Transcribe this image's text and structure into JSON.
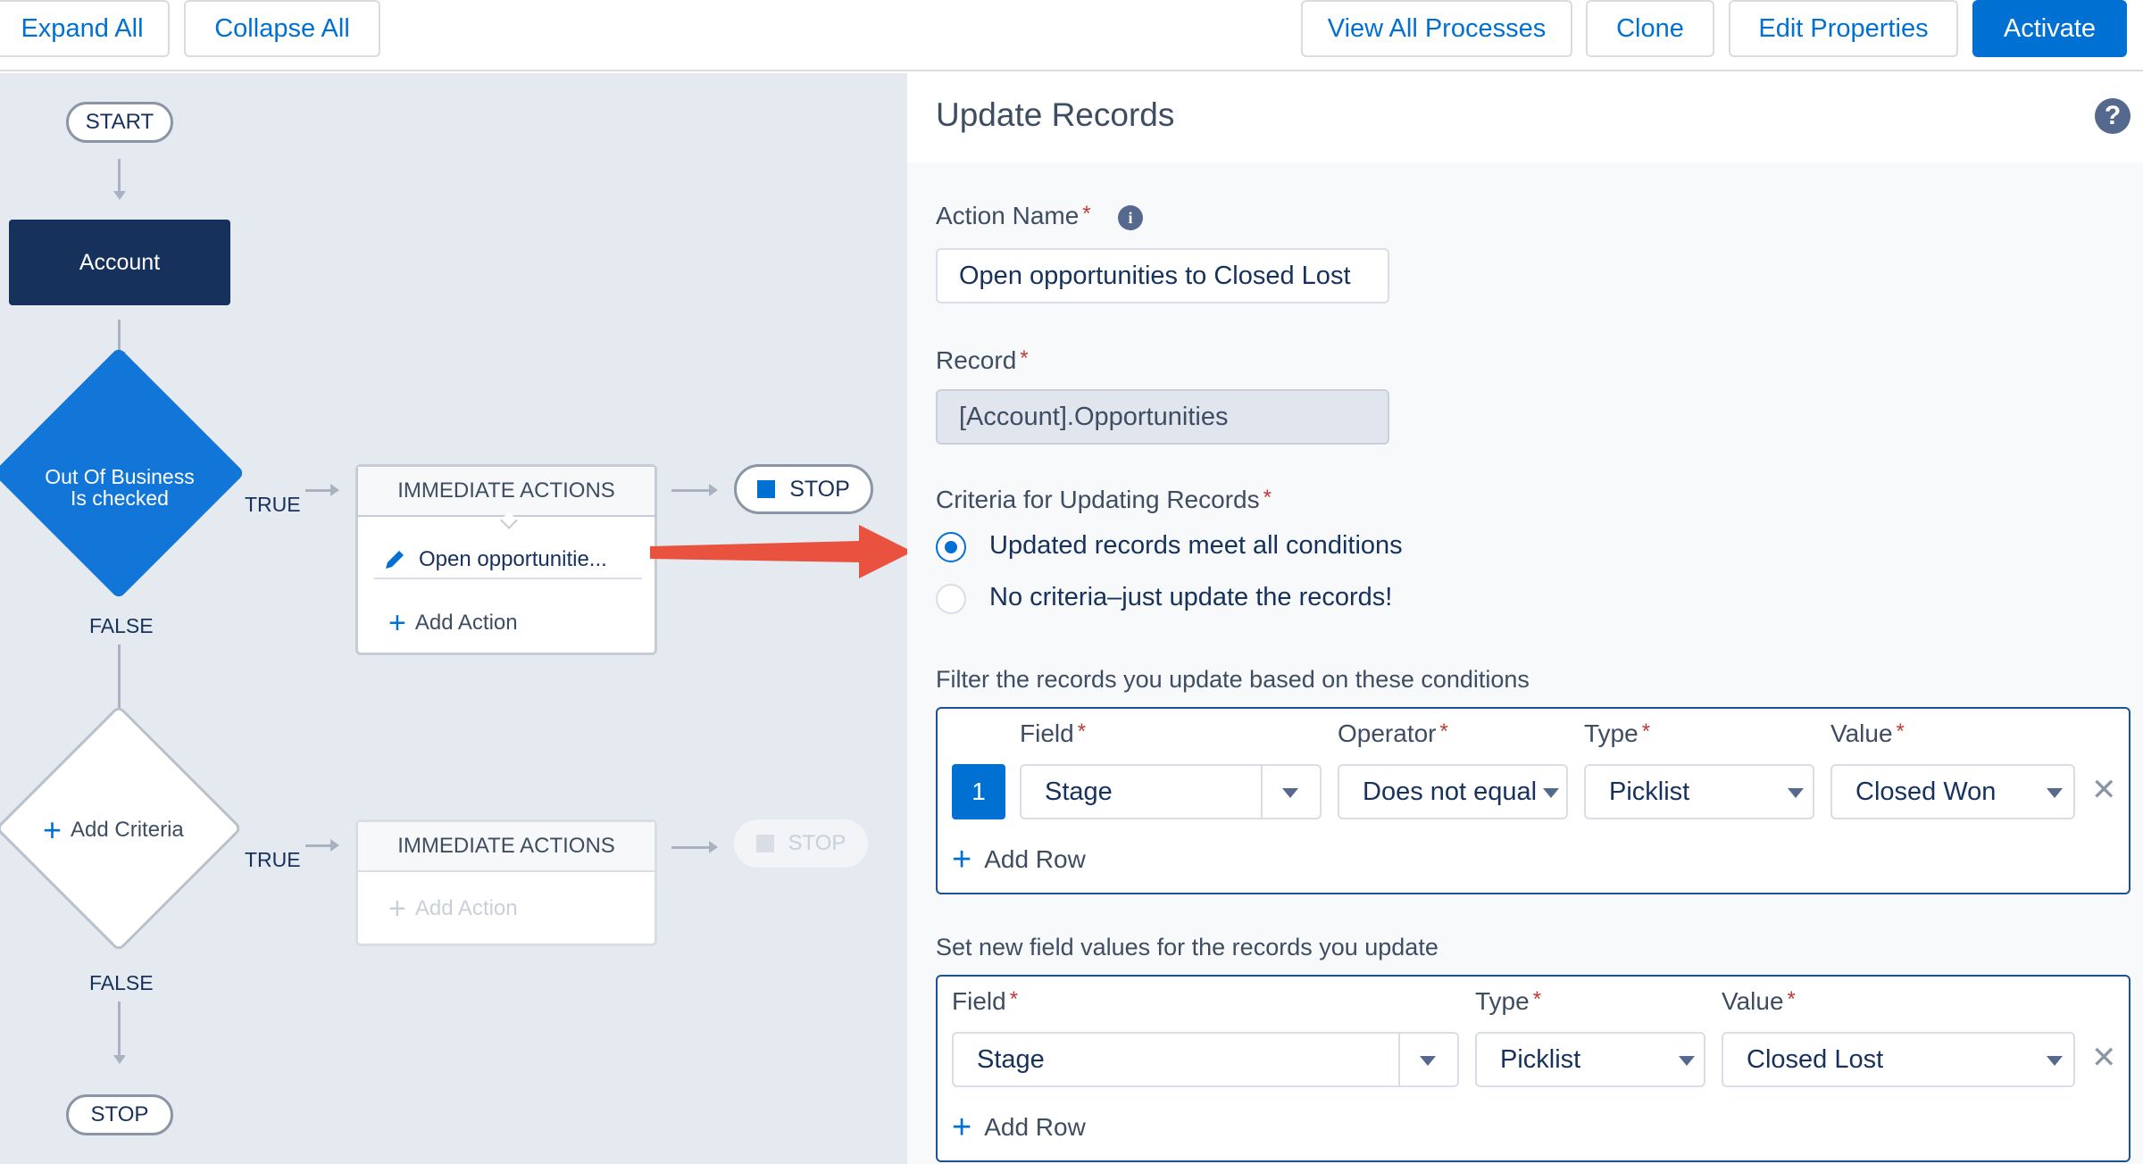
{
  "toolbar": {
    "expand_all": "Expand All",
    "collapse_all": "Collapse All",
    "view_all_processes": "View All Processes",
    "clone": "Clone",
    "edit_properties": "Edit Properties",
    "activate": "Activate"
  },
  "canvas": {
    "start_label": "START",
    "object_node": "Account",
    "criteria1_line1": "Out Of Business",
    "criteria1_line2": "Is checked",
    "true_label1": "TRUE",
    "false_label1": "FALSE",
    "immediate_actions1": "IMMEDIATE ACTIONS",
    "action1_label": "Open opportunitie...",
    "add_action1": "Add Action",
    "stop1": "STOP",
    "add_criteria": "Add Criteria",
    "true_label2": "TRUE",
    "false_label2": "FALSE",
    "immediate_actions2": "IMMEDIATE ACTIONS",
    "add_action2": "Add Action",
    "stop2": "STOP",
    "stop_end": "STOP"
  },
  "panel": {
    "title": "Update Records",
    "action_name_label": "Action Name",
    "action_name_value": "Open opportunities to Closed Lost",
    "record_label": "Record",
    "record_value": "[Account].Opportunities",
    "criteria_label": "Criteria for Updating Records",
    "radio_all": "Updated records meet all conditions",
    "radio_none": "No criteria–just update the records!",
    "filter_heading": "Filter the records you update based on these conditions",
    "filter": {
      "col_field": "Field",
      "col_operator": "Operator",
      "col_type": "Type",
      "col_value": "Value",
      "row_number": "1",
      "field": "Stage",
      "operator": "Does not equal",
      "type": "Picklist",
      "value": "Closed Won",
      "add_row": "Add Row"
    },
    "set_heading": "Set new field values for the records you update",
    "set": {
      "col_field": "Field",
      "col_type": "Type",
      "col_value": "Value",
      "field": "Stage",
      "type": "Picklist",
      "value": "Closed Lost",
      "add_row": "Add Row"
    }
  },
  "colors": {
    "brand": "#0070d2",
    "navy": "#16325c",
    "diamond": "#1276d8",
    "arrow": "#e8523f"
  }
}
